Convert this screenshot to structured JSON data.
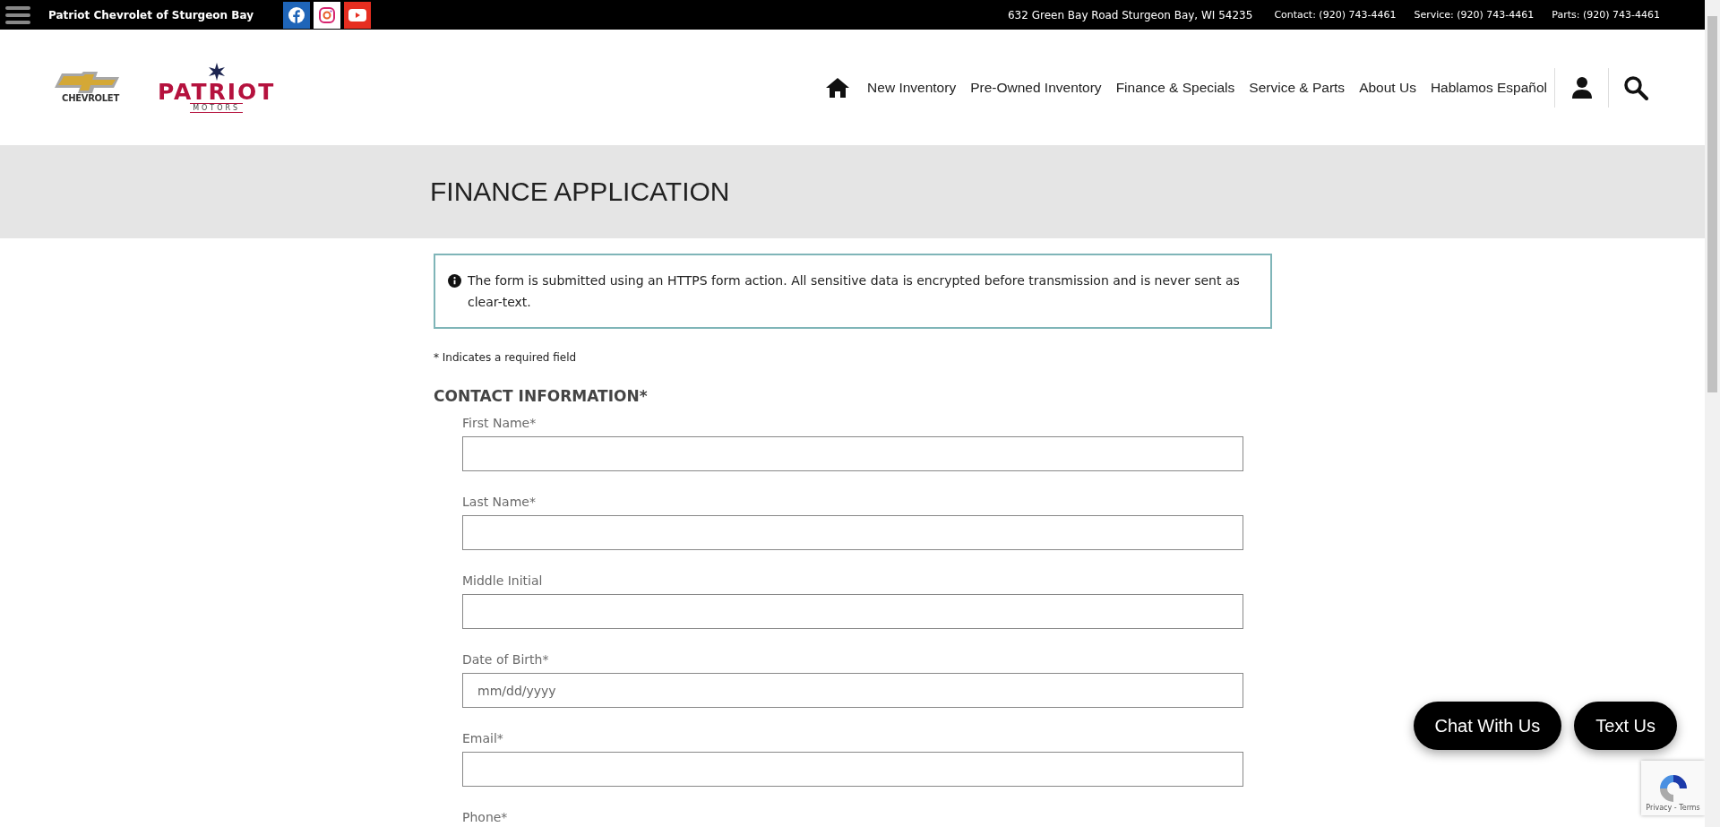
{
  "top_bar": {
    "dealer_name": "Patriot Chevrolet of Sturgeon Bay",
    "address": "632 Green Bay Road Sturgeon Bay, WI 54235",
    "contacts": [
      "Contact: (920) 743-4461",
      "Service: (920) 743-4461",
      "Parts: (920) 743-4461"
    ]
  },
  "logos": {
    "chevrolet": "CHEVROLET",
    "patriot": "PATRIOT",
    "patriot_sub": "MOTORS"
  },
  "nav": [
    "New Inventory",
    "Pre-Owned Inventory",
    "Finance & Specials",
    "Service & Parts",
    "About Us",
    "Hablamos Español"
  ],
  "page_title": "FINANCE APPLICATION",
  "notice": "The form is submitted using an HTTPS form action. All sensitive data is encrypted before transmission and is never sent as clear-text.",
  "required_note": "* Indicates a required field",
  "section_title": "CONTACT INFORMATION*",
  "fields": [
    {
      "label": "First Name*"
    },
    {
      "label": "Last Name*"
    },
    {
      "label": "Middle Initial"
    },
    {
      "label": "Date of Birth*",
      "placeholder": "mm/dd/yyyy"
    },
    {
      "label": "Email*"
    },
    {
      "label": "Phone*"
    }
  ],
  "floating_buttons": [
    "Chat With Us",
    "Text Us"
  ],
  "recaptcha": "Privacy - Terms"
}
